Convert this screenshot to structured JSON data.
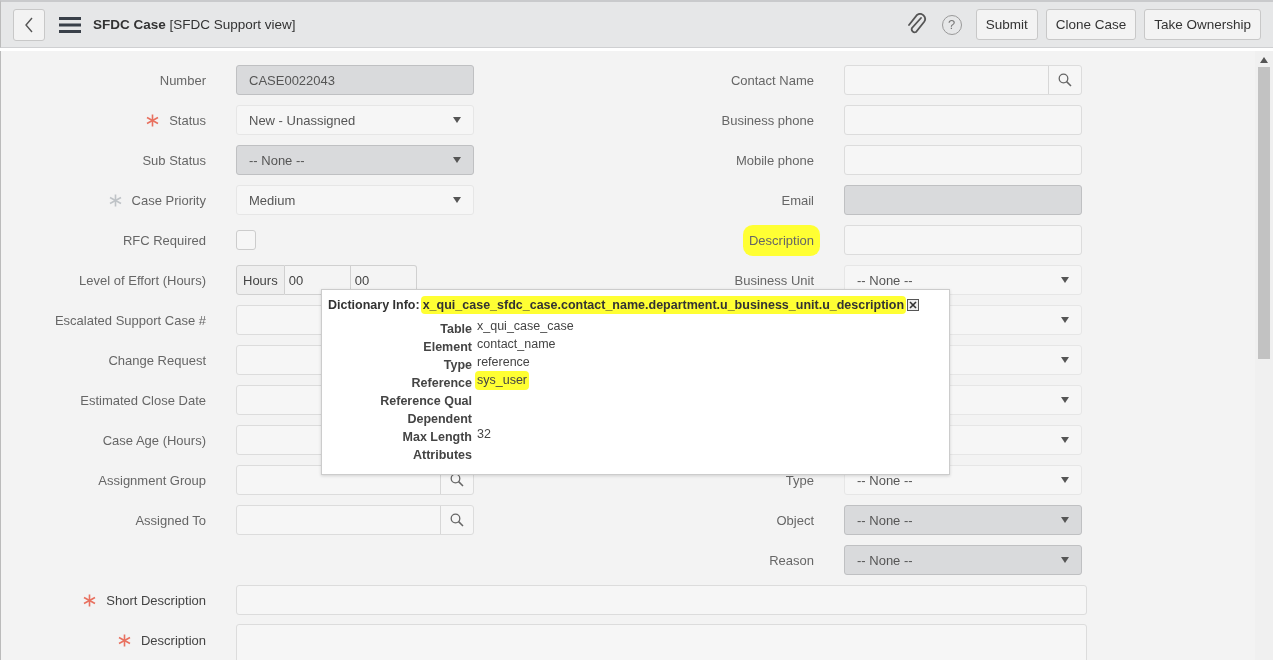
{
  "header": {
    "title": "**SFDC Case** [SFDC Support view]",
    "help": "?",
    "buttons": [
      "Submit",
      "Clone Case",
      "Take Ownership"
    ]
  },
  "left_fields": [
    {
      "label": "Number",
      "kind": "text",
      "value": "CASE0022043",
      "readonly": true,
      "mandatory": false
    },
    {
      "label": "Status",
      "kind": "select",
      "value": "New - Unassigned",
      "readonly": false,
      "mandatory": true,
      "satisfied": false
    },
    {
      "label": "Sub Status",
      "kind": "select",
      "value": "-- None --",
      "readonly": true,
      "mandatory": false
    },
    {
      "label": "Case Priority",
      "kind": "select",
      "value": "Medium",
      "readonly": false,
      "mandatory": true,
      "satisfied": true
    },
    {
      "label": "RFC Required",
      "kind": "checkbox",
      "checked": false,
      "mandatory": false
    },
    {
      "label": "Level of Effort (Hours)",
      "kind": "duration",
      "unit": "Hours",
      "parts": [
        "00",
        "00"
      ],
      "mandatory": false
    },
    {
      "label": "Escalated Support Case #",
      "kind": "text",
      "readonly": false,
      "mandatory": false
    },
    {
      "label": "Change Request",
      "kind": "text",
      "readonly": false,
      "mandatory": false
    },
    {
      "label": "Estimated Close Date",
      "kind": "text",
      "readonly": false,
      "mandatory": false
    },
    {
      "label": "Case Age (Hours)",
      "kind": "text",
      "readonly": false,
      "mandatory": false
    },
    {
      "label": "Assignment Group",
      "kind": "reference",
      "readonly": false,
      "mandatory": false
    },
    {
      "label": "Assigned To",
      "kind": "reference",
      "readonly": false,
      "mandatory": false
    }
  ],
  "right_fields": [
    {
      "label": "Contact Name",
      "kind": "reference",
      "readonly": false,
      "mandatory": false
    },
    {
      "label": "Business phone",
      "kind": "text",
      "readonly": false,
      "mandatory": false
    },
    {
      "label": "Mobile phone",
      "kind": "text",
      "readonly": false,
      "mandatory": false
    },
    {
      "label": "Email",
      "kind": "text",
      "readonly": true,
      "mandatory": false
    },
    {
      "label": "Description",
      "kind": "text",
      "readonly": false,
      "mandatory": false,
      "highlighted": true
    },
    {
      "label": "Business Unit",
      "kind": "select",
      "value": "-- None --",
      "readonly": false,
      "mandatory": false
    },
    {
      "kind": "select",
      "readonly": false
    },
    {
      "kind": "select",
      "readonly": false
    },
    {
      "kind": "select",
      "readonly": false
    },
    {
      "kind": "select",
      "readonly": false
    },
    {
      "label": "Type",
      "kind": "select",
      "value": "-- None --",
      "readonly": false,
      "mandatory": false
    },
    {
      "label": "Object",
      "kind": "select",
      "value": "-- None --",
      "readonly": true,
      "mandatory": false
    },
    {
      "label": "Reason",
      "kind": "select",
      "value": "-- None --",
      "readonly": true,
      "mandatory": false
    }
  ],
  "wide_fields": [
    {
      "label": "Short Description",
      "kind": "text",
      "readonly": false,
      "mandatory": true,
      "satisfied": false
    },
    {
      "label": "Description",
      "kind": "textarea",
      "readonly": false,
      "mandatory": true,
      "satisfied": false
    }
  ],
  "dictionary_popup": {
    "title": "Dictionary Info:",
    "path": "x_qui_case_sfdc_case.contact_name.department.u_business_unit.u_description",
    "path_highlighted": true,
    "rows": [
      {
        "label": "Table",
        "value": "x_qui_case_case"
      },
      {
        "label": "Element",
        "value": "contact_name"
      },
      {
        "label": "Type",
        "value": "reference"
      },
      {
        "label": "Reference",
        "value": "sys_user",
        "highlighted": true
      },
      {
        "label": "Reference Qual"
      },
      {
        "label": "Dependent"
      },
      {
        "label": "Max Length",
        "value": "32"
      },
      {
        "label": "Attributes"
      }
    ]
  }
}
